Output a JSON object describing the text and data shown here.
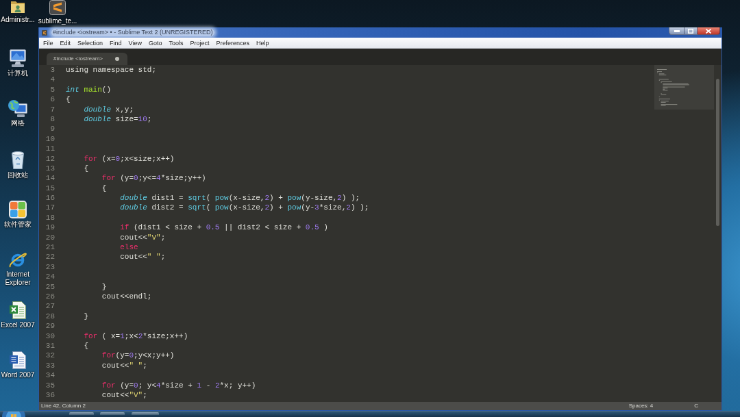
{
  "desktop": {
    "top_row": [
      {
        "kind": "folder",
        "label": "Administr..."
      },
      {
        "kind": "app",
        "label": "sublime_te..."
      }
    ],
    "column": [
      {
        "kind": "computer",
        "label": "计算机"
      },
      {
        "kind": "network",
        "label": "网络"
      },
      {
        "kind": "trash",
        "label": "回收站"
      },
      {
        "kind": "tiles",
        "label": "软件管家"
      },
      {
        "kind": "browser",
        "label": "Internet Explorer"
      },
      {
        "kind": "spreadsheet",
        "label": "Excel 2007"
      },
      {
        "kind": "document",
        "label": "Word 2007"
      }
    ]
  },
  "window": {
    "title": "#include <iostream> • - Sublime Text 2 (UNREGISTERED)",
    "menu": [
      "File",
      "Edit",
      "Selection",
      "Find",
      "View",
      "Goto",
      "Tools",
      "Project",
      "Preferences",
      "Help"
    ],
    "tabs": [
      {
        "label": "#include <iostream>",
        "selected": true,
        "modified": true
      }
    ],
    "editor": {
      "lines": [
        {
          "number": "3",
          "tokens": [
            {
              "kind": "plain",
              "text": "using namespace std;"
            }
          ]
        },
        {
          "number": "4"
        },
        {
          "number": "5",
          "tokens": [
            {
              "kind": "type",
              "text": "int"
            },
            {
              "kind": "entity",
              "text": " main"
            },
            {
              "kind": "plain",
              "text": "()"
            }
          ]
        },
        {
          "number": "6",
          "tokens": [
            {
              "kind": "plain",
              "text": "{"
            }
          ]
        },
        {
          "number": "7",
          "tokens": [
            {
              "kind": "type",
              "text": "    double"
            },
            {
              "kind": "plain",
              "text": " x,y;"
            }
          ]
        },
        {
          "number": "8",
          "tokens": [
            {
              "kind": "type",
              "text": "    double"
            },
            {
              "kind": "plain",
              "text": " size="
            },
            {
              "kind": "number",
              "text": "10"
            },
            {
              "kind": "plain",
              "text": ";"
            }
          ]
        },
        {
          "number": "9"
        },
        {
          "number": "10"
        },
        {
          "number": "11"
        },
        {
          "number": "12",
          "tokens": [
            {
              "kind": "keyword",
              "text": "    for"
            },
            {
              "kind": "plain",
              "text": " (x="
            },
            {
              "kind": "number",
              "text": "0"
            },
            {
              "kind": "plain",
              "text": ";x<size;x++)"
            }
          ]
        },
        {
          "number": "13",
          "tokens": [
            {
              "kind": "plain",
              "text": "    {"
            }
          ]
        },
        {
          "number": "14",
          "tokens": [
            {
              "kind": "keyword",
              "text": "        for"
            },
            {
              "kind": "plain",
              "text": " (y="
            },
            {
              "kind": "number",
              "text": "0"
            },
            {
              "kind": "plain",
              "text": ";y<="
            },
            {
              "kind": "number",
              "text": "4"
            },
            {
              "kind": "plain",
              "text": "*size;y++)"
            }
          ]
        },
        {
          "number": "15",
          "tokens": [
            {
              "kind": "plain",
              "text": "        {"
            }
          ]
        },
        {
          "number": "16",
          "tokens": [
            {
              "kind": "type",
              "text": "            double"
            },
            {
              "kind": "plain",
              "text": " dist1 = "
            },
            {
              "kind": "function",
              "text": "sqrt"
            },
            {
              "kind": "plain",
              "text": "( "
            },
            {
              "kind": "function",
              "text": "pow"
            },
            {
              "kind": "plain",
              "text": "(x-size,"
            },
            {
              "kind": "number",
              "text": "2"
            },
            {
              "kind": "plain",
              "text": ") + "
            },
            {
              "kind": "function",
              "text": "pow"
            },
            {
              "kind": "plain",
              "text": "(y-size,"
            },
            {
              "kind": "number",
              "text": "2"
            },
            {
              "kind": "plain",
              "text": ") );"
            }
          ]
        },
        {
          "number": "17",
          "tokens": [
            {
              "kind": "type",
              "text": "            double"
            },
            {
              "kind": "plain",
              "text": " dist2 = "
            },
            {
              "kind": "function",
              "text": "sqrt"
            },
            {
              "kind": "plain",
              "text": "( "
            },
            {
              "kind": "function",
              "text": "pow"
            },
            {
              "kind": "plain",
              "text": "(x-size,"
            },
            {
              "kind": "number",
              "text": "2"
            },
            {
              "kind": "plain",
              "text": ") + "
            },
            {
              "kind": "function",
              "text": "pow"
            },
            {
              "kind": "plain",
              "text": "(y-"
            },
            {
              "kind": "number",
              "text": "3"
            },
            {
              "kind": "plain",
              "text": "*size,"
            },
            {
              "kind": "number",
              "text": "2"
            },
            {
              "kind": "plain",
              "text": ") );"
            }
          ]
        },
        {
          "number": "18"
        },
        {
          "number": "19",
          "tokens": [
            {
              "kind": "keyword",
              "text": "            if"
            },
            {
              "kind": "plain",
              "text": " (dist1 < size + "
            },
            {
              "kind": "number",
              "text": "0.5"
            },
            {
              "kind": "plain",
              "text": " || dist2 < size + "
            },
            {
              "kind": "number",
              "text": "0.5"
            },
            {
              "kind": "plain",
              "text": " )"
            }
          ]
        },
        {
          "number": "20",
          "tokens": [
            {
              "kind": "plain",
              "text": "            cout<<"
            },
            {
              "kind": "string",
              "text": "\"V\""
            },
            {
              "kind": "plain",
              "text": ";"
            }
          ]
        },
        {
          "number": "21",
          "tokens": [
            {
              "kind": "keyword",
              "text": "            else"
            }
          ]
        },
        {
          "number": "22",
          "tokens": [
            {
              "kind": "plain",
              "text": "            cout<<"
            },
            {
              "kind": "string",
              "text": "\" \""
            },
            {
              "kind": "plain",
              "text": ";"
            }
          ]
        },
        {
          "number": "23"
        },
        {
          "number": "24"
        },
        {
          "number": "25",
          "tokens": [
            {
              "kind": "plain",
              "text": "        }"
            }
          ]
        },
        {
          "number": "26",
          "tokens": [
            {
              "kind": "plain",
              "text": "        cout<<endl;"
            }
          ]
        },
        {
          "number": "27"
        },
        {
          "number": "28",
          "tokens": [
            {
              "kind": "plain",
              "text": "    }"
            }
          ]
        },
        {
          "number": "29"
        },
        {
          "number": "30",
          "tokens": [
            {
              "kind": "keyword",
              "text": "    for"
            },
            {
              "kind": "plain",
              "text": " ( x="
            },
            {
              "kind": "number",
              "text": "1"
            },
            {
              "kind": "plain",
              "text": ";x<"
            },
            {
              "kind": "number",
              "text": "2"
            },
            {
              "kind": "plain",
              "text": "*size;x++)"
            }
          ]
        },
        {
          "number": "31",
          "tokens": [
            {
              "kind": "plain",
              "text": "    {"
            }
          ]
        },
        {
          "number": "32",
          "tokens": [
            {
              "kind": "keyword",
              "text": "        for"
            },
            {
              "kind": "plain",
              "text": "(y="
            },
            {
              "kind": "number",
              "text": "0"
            },
            {
              "kind": "plain",
              "text": ";y<x;y++)"
            }
          ]
        },
        {
          "number": "33",
          "tokens": [
            {
              "kind": "plain",
              "text": "        cout<<"
            },
            {
              "kind": "string",
              "text": "\" \""
            },
            {
              "kind": "plain",
              "text": ";"
            }
          ]
        },
        {
          "number": "34"
        },
        {
          "number": "35",
          "tokens": [
            {
              "kind": "keyword",
              "text": "        for"
            },
            {
              "kind": "plain",
              "text": " (y="
            },
            {
              "kind": "number",
              "text": "0"
            },
            {
              "kind": "plain",
              "text": "; y<"
            },
            {
              "kind": "number",
              "text": "4"
            },
            {
              "kind": "plain",
              "text": "*size + "
            },
            {
              "kind": "number",
              "text": "1"
            },
            {
              "kind": "plain",
              "text": " - "
            },
            {
              "kind": "number",
              "text": "2"
            },
            {
              "kind": "plain",
              "text": "*x; y++)"
            }
          ]
        },
        {
          "number": "36",
          "tokens": [
            {
              "kind": "plain",
              "text": "        cout<<"
            },
            {
              "kind": "string",
              "text": "\"V\""
            },
            {
              "kind": "plain",
              "text": ";"
            }
          ]
        }
      ]
    },
    "status_bar": {
      "cursor": "Line 42, Column 2",
      "indentation": "Spaces: 4",
      "syntax": "C"
    }
  }
}
